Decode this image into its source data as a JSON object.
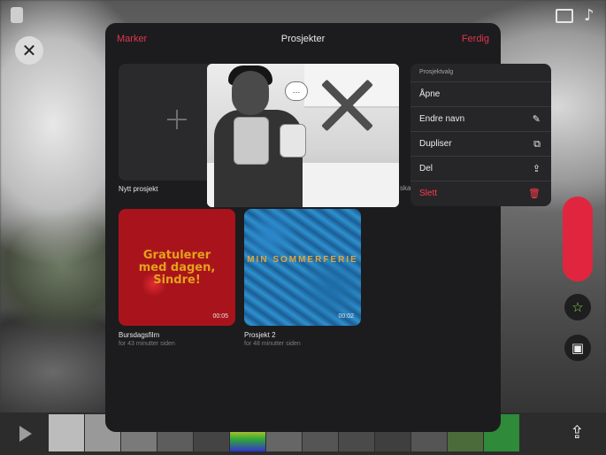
{
  "header": {
    "select_label": "Marker",
    "title": "Prosjekter",
    "done_label": "Ferdig"
  },
  "new_project": {
    "label": "Nytt prosjekt"
  },
  "projects": [
    {
      "title": "Bursdagsfilm",
      "subtitle": "for 43 minutter siden",
      "duration": "00:05",
      "thumb_text": "Gratulerer med dagen, Sindre!"
    },
    {
      "title": "Prosjekt 2",
      "subtitle": "for 48 minutter siden",
      "duration": "00:02",
      "thumb_text": "MIN SOMMERFERIE"
    }
  ],
  "partial_card_label": "ska",
  "context_menu": {
    "title": "Prosjektvalg",
    "items": [
      {
        "label": "Åpne",
        "icon": "",
        "danger": false
      },
      {
        "label": "Endre navn",
        "icon": "edit-icon",
        "danger": false
      },
      {
        "label": "Dupliser",
        "icon": "duplicate-icon",
        "danger": false
      },
      {
        "label": "Del",
        "icon": "share-icon",
        "danger": false
      },
      {
        "label": "Slett",
        "icon": "trash-icon",
        "danger": true
      }
    ]
  },
  "preview": {
    "bubble_text": "…"
  },
  "colors": {
    "accent": "#e0364f",
    "danger": "#ff3b4e",
    "modal_bg": "#1c1c1e"
  }
}
